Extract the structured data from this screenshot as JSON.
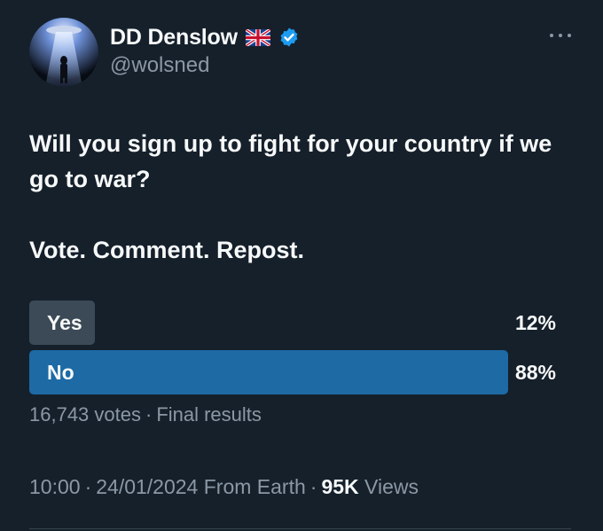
{
  "author": {
    "display_name": "DD Denslow",
    "handle": "@wolsned",
    "flag_icon": "uk-flag-icon",
    "verified_icon": "verified-badge-icon",
    "verified_color": "#1d9bf0"
  },
  "tweet": {
    "lines": [
      "Will you sign up to fight for your country if we go to war?",
      "Vote. Comment. Repost."
    ]
  },
  "poll": {
    "options": [
      {
        "label": "Yes",
        "percent_text": "12%",
        "percent": 12,
        "winner": false,
        "color": "#3c4a57"
      },
      {
        "label": "No",
        "percent_text": "88%",
        "percent": 88,
        "winner": true,
        "color": "#1d6aa5"
      }
    ],
    "votes": "16,743 votes",
    "status": "Final results"
  },
  "footer": {
    "time": "10:00",
    "date": "24/01/2024",
    "source": "From Earth",
    "views_count": "95K",
    "views_label": "Views"
  },
  "colors": {
    "background": "#15202b",
    "text_primary": "#f7f9f9",
    "text_secondary": "#8b98a5"
  }
}
